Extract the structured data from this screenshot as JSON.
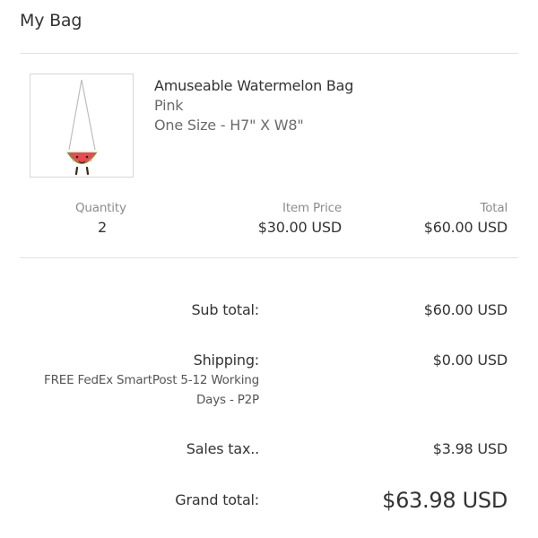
{
  "header": {
    "title": "My Bag"
  },
  "item": {
    "name": "Amuseable Watermelon Bag",
    "color": "Pink",
    "size": "One Size - H7\" X W8\"",
    "image_icon": "watermelon-bag-image",
    "quantity_label": "Quantity",
    "quantity": "2",
    "price_label": "Item Price",
    "price": "$30.00 USD",
    "total_label": "Total",
    "total": "$60.00 USD"
  },
  "summary": {
    "subtotal_label": "Sub total:",
    "subtotal": "$60.00 USD",
    "shipping_label": "Shipping:",
    "shipping_method_line1": "FREE FedEx SmartPost 5-12 Working",
    "shipping_method_line2": "Days - P2P",
    "shipping": "$0.00 USD",
    "tax_label": "Sales tax..",
    "tax": "$3.98 USD",
    "grand_total_label": "Grand total:",
    "grand_total": "$63.98 USD"
  },
  "colors": {
    "text": "#333333",
    "muted": "#8c8c8c",
    "divider": "#e2e2e2",
    "watermelon_red": "#e84a4f",
    "watermelon_green": "#6f9c3d"
  }
}
